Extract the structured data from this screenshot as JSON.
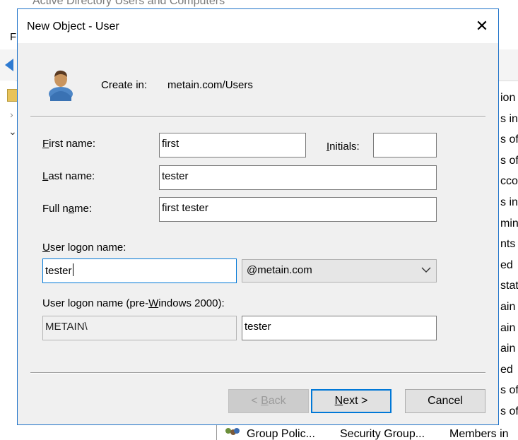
{
  "background_window": {
    "title": "Active Directory Users and Computers",
    "menu_first_letter": "F",
    "right_column_fragments": [
      "ion",
      "s in",
      "s of",
      "s of",
      "cco",
      "s in",
      "min",
      "nts",
      "ed",
      "stat",
      "ain",
      "ain",
      "ain",
      "ed",
      "s of",
      "s of"
    ],
    "bottom_row": {
      "name": "Group Polic...",
      "type": "Security Group...",
      "description": "Members in"
    }
  },
  "dialog": {
    "title": "New Object - User",
    "close_glyph": "✕",
    "create_in_label": "Create in:",
    "create_in_value": "metain.com/Users",
    "first_name": {
      "label_mnemonic": "F",
      "label_rest": "irst name:",
      "value": "first"
    },
    "initials": {
      "label_mnemonic": "I",
      "label_rest": "nitials:",
      "value": ""
    },
    "last_name": {
      "label_mnemonic": "L",
      "label_rest": "ast name:",
      "value": "tester"
    },
    "full_name": {
      "label_pre": "Full n",
      "label_mnemonic": "a",
      "label_rest": "me:",
      "value": "first tester"
    },
    "logon_name": {
      "label_mnemonic": "U",
      "label_rest": "ser logon name:",
      "value": "tester"
    },
    "upn_suffix": {
      "selected": "@metain.com"
    },
    "pre2000": {
      "label_pre": "User logon name (pre-",
      "label_mnemonic": "W",
      "label_rest": "indows 2000):",
      "domain": "METAIN\\",
      "value": "tester"
    },
    "buttons": {
      "back": {
        "prefix": "< ",
        "mnemonic": "B",
        "rest": "ack"
      },
      "next": {
        "mnemonic": "N",
        "rest": "ext >"
      },
      "cancel": "Cancel"
    }
  }
}
